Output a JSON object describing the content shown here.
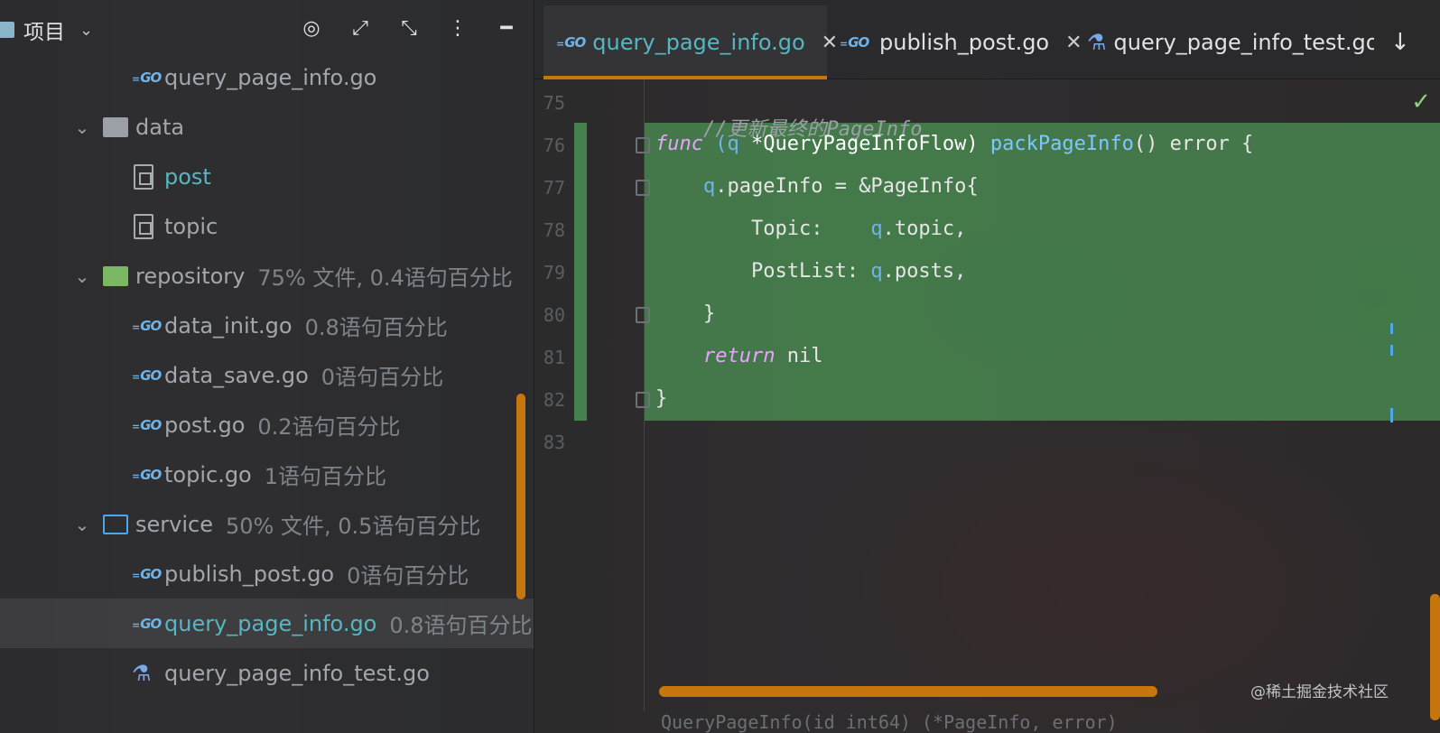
{
  "project_panel": {
    "title": "项目",
    "items": [
      {
        "label": "query_page_info.go",
        "hint": "",
        "kind": "go",
        "level": 2
      },
      {
        "label": "data",
        "hint": "",
        "kind": "folder",
        "level": 1
      },
      {
        "label": "post",
        "hint": "",
        "kind": "file",
        "level": 2
      },
      {
        "label": "topic",
        "hint": "",
        "kind": "file",
        "level": 2
      },
      {
        "label": "repository",
        "hint": "75% 文件, 0.4语句百分比",
        "kind": "folder",
        "level": 1
      },
      {
        "label": "data_init.go",
        "hint": "0.8语句百分比",
        "kind": "go",
        "level": 2
      },
      {
        "label": "data_save.go",
        "hint": "0语句百分比",
        "kind": "go",
        "level": 2
      },
      {
        "label": "post.go",
        "hint": "0.2语句百分比",
        "kind": "go",
        "level": 2
      },
      {
        "label": "topic.go",
        "hint": "1语句百分比",
        "kind": "go",
        "level": 2
      },
      {
        "label": "service",
        "hint": "50% 文件, 0.5语句百分比",
        "kind": "folder",
        "level": 1
      },
      {
        "label": "publish_post.go",
        "hint": "0语句百分比",
        "kind": "go",
        "level": 2
      },
      {
        "label": "query_page_info.go",
        "hint": "0.8语句百分比",
        "kind": "go",
        "level": 2
      },
      {
        "label": "query_page_info_test.go",
        "hint": "",
        "kind": "test",
        "level": 2
      }
    ]
  },
  "tabs": [
    {
      "label": "query_page_info.go",
      "active": true
    },
    {
      "label": "publish_post.go",
      "active": false
    },
    {
      "label": "query_page_info_test.go",
      "active": false
    }
  ],
  "gutter": [
    "75",
    "76",
    "77",
    "78",
    "79",
    "80",
    "81",
    "82",
    "83"
  ],
  "code": {
    "comment": "//更新最终的PageInfo",
    "l76_kw": "func",
    "l76_recv": "(q ",
    "l76_type": "*QueryPageInfoFlow) ",
    "l76_fn": "packPageInfo",
    "l76_rest": "() error {",
    "l77_recv": "q",
    "l77_rest": ".pageInfo = &PageInfo{",
    "l78_key": "Topic:    ",
    "l78_recv": "q",
    "l78_rest": ".topic,",
    "l79_key": "PostList: ",
    "l79_recv": "q",
    "l79_rest": ".posts,",
    "l80": "}",
    "l81_kw": "return",
    "l81_rest": " nil",
    "l82": "}"
  },
  "status_hint": "QueryPageInfo(id int64) (*PageInfo, error)",
  "watermark": "@稀土掘金技术社区",
  "colors": {
    "accent": "#c7760d",
    "change_band": "#498a50",
    "go_icon": "#6fb4e9"
  }
}
